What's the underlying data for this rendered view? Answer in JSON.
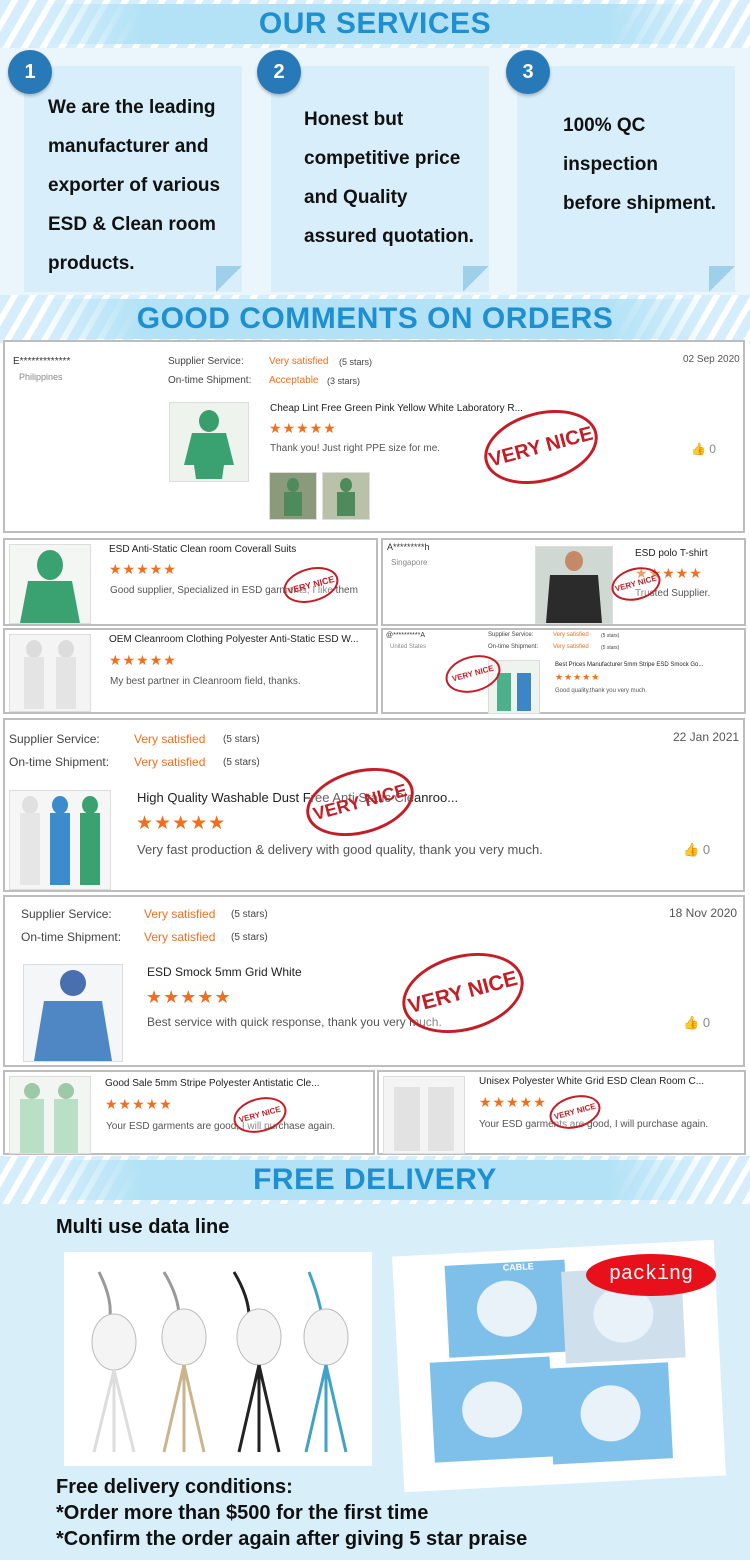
{
  "services": {
    "title": "OUR SERVICES",
    "items": [
      {
        "num": "1",
        "lines": [
          "We are the leading",
          "manufacturer and",
          "exporter of various",
          "ESD & Clean room",
          "products."
        ]
      },
      {
        "num": "2",
        "lines": [
          "Honest but",
          "competitive price",
          "and Quality",
          "assured quotation."
        ]
      },
      {
        "num": "3",
        "lines": [
          "100% QC",
          "inspection",
          "before shipment."
        ]
      }
    ]
  },
  "comments_title": "GOOD COMMENTS ON ORDERS",
  "review1": {
    "user": "E*************",
    "country": "Philippines",
    "supplier_label": "Supplier Service:",
    "supplier_value": "Very satisfied",
    "supplier_stars": "(5 stars)",
    "shipment_label": "On-time Shipment:",
    "shipment_value": "Acceptable",
    "shipment_stars": "(3 stars)",
    "date": "02 Sep 2020",
    "product": "Cheap Lint Free Green Pink Yellow White Laboratory R...",
    "comment": "Thank you! Just right PPE size for me.",
    "likes": "0"
  },
  "stamp_text": "VERY NICE",
  "stars": "★★★★★",
  "review2a": {
    "product": "ESD Anti-Static Clean room Coverall Suits",
    "comment": "Good supplier, Specialized in ESD garments, I like them"
  },
  "review2b": {
    "user": "A*********h",
    "country": "Singapore",
    "product": "ESD polo T-shirt",
    "comment": "Trusted Supplier."
  },
  "review3a": {
    "product": "OEM Cleanroom Clothing Polyester Anti-Static ESD W...",
    "comment": "My best partner in Cleanroom field, thanks."
  },
  "review3b": {
    "user": "@**********A",
    "country": "United States",
    "supplier_label": "Supplier Service:",
    "supplier_value": "Very satisfied",
    "supplier_stars": "(5 stars)",
    "shipment_label": "On-time Shipment:",
    "shipment_value": "Very satisfied",
    "shipment_stars": "(5 stars)",
    "product": "Best Prices Manufacturer 5mm Stripe ESD Smock Go...",
    "comment": "Good quality,thank you very much."
  },
  "review4": {
    "supplier_label": "Supplier Service:",
    "supplier_value": "Very satisfied",
    "supplier_stars": "(5 stars)",
    "shipment_label": "On-time Shipment:",
    "shipment_value": "Very satisfied",
    "shipment_stars": "(5 stars)",
    "date": "22 Jan 2021",
    "product": "High Quality Washable Dust Free Anti Static Cleanroo...",
    "comment": "Very fast production & delivery with good quality, thank you very much.",
    "likes": "0"
  },
  "review5": {
    "supplier_label": "Supplier Service:",
    "supplier_value": "Very satisfied",
    "supplier_stars": "(5 stars)",
    "shipment_label": "On-time Shipment:",
    "shipment_value": "Very satisfied",
    "shipment_stars": "(5 stars)",
    "date": "18 Nov 2020",
    "product": "ESD Smock 5mm Grid White",
    "comment": "Best service with quick response, thank you very much.",
    "likes": "0"
  },
  "review6a": {
    "product": "Good Sale 5mm Stripe Polyester Antistatic Cle...",
    "comment": "Your ESD garments are good, I will purchase again."
  },
  "review6b": {
    "product": "Unisex Polyester White Grid ESD Clean Room C...",
    "comment": "Your ESD garments are good, I will purchase again."
  },
  "delivery": {
    "title": "FREE DELIVERY",
    "subtitle": "Multi use data line",
    "packing": "packing",
    "cable_label": "CABLE",
    "conditions_title": "Free delivery conditions:",
    "conditions": [
      "*Order more than $500 for the first time",
      "*Confirm the order again after giving 5 star praise"
    ]
  },
  "colors": {
    "accent": "#1e8fd0",
    "orange": "#f26e1d",
    "stamp": "#c41d25",
    "badge": "#2779b8"
  }
}
